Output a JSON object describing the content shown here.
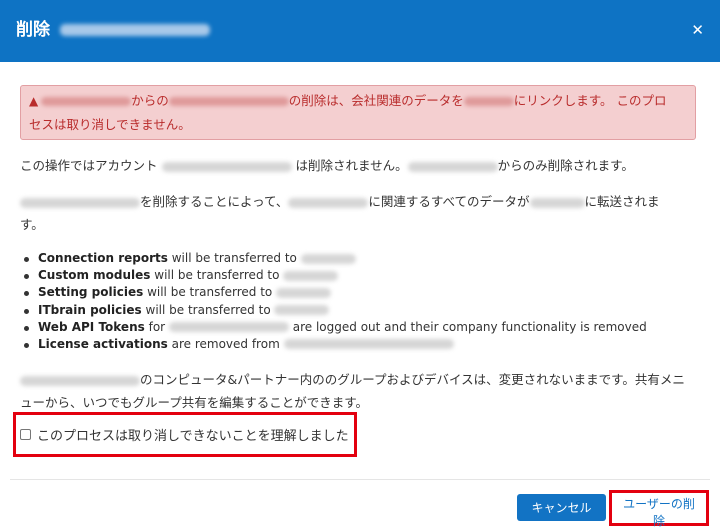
{
  "header": {
    "title": "削除"
  },
  "alert": {
    "part1": "からの",
    "part2": "の削除は、会社関連のデータを",
    "part3": "にリンクします。 このプロ",
    "line2": "セスは取り消しできません。"
  },
  "account_para": {
    "part1": "この操作ではアカウント",
    "part2": "は削除されません。",
    "part3": "からのみ削除されます。"
  },
  "transfer_para": {
    "part1": "を削除することによって、",
    "part2": "に関連するすべてのデータが",
    "part3": "に転送されま",
    "line2": "す。"
  },
  "bullets": [
    {
      "bold": "Connection reports",
      "text": "will be transferred to"
    },
    {
      "bold": "Custom modules",
      "text": "will be transferred to"
    },
    {
      "bold": "Setting policies",
      "text": "will be transferred to"
    },
    {
      "bold": "ITbrain policies",
      "text": "will be transferred to"
    },
    {
      "bold": "Web API Tokens",
      "text": "for",
      "text2": "are logged out and their company functionality is removed"
    },
    {
      "bold": "License activations",
      "text": "are removed from"
    }
  ],
  "groups_para": {
    "line1": "のコンピュータ&パートナー内ののグループおよびデバイスは、変更されないままです。共有メニ",
    "line2": "ューから、いつでもグループ共有を編集することができます。"
  },
  "confirm": {
    "label": "このプロセスは取り消しできないことを理解しました",
    "checked": false
  },
  "buttons": {
    "cancel": "キャンセル",
    "delete": "ユーザーの削除"
  },
  "colors": {
    "header": "#0e73c4",
    "alert_bg": "#f4cfd0",
    "alert_text": "#b92c2c",
    "highlight": "#e3000f"
  }
}
